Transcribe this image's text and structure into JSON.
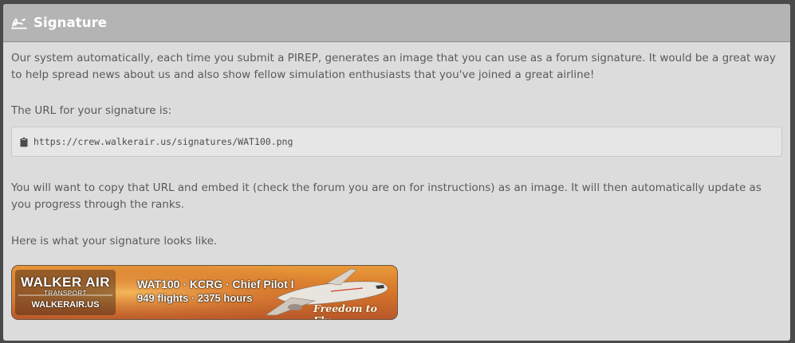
{
  "panel": {
    "title": "Signature",
    "icon": "signature-icon"
  },
  "content": {
    "intro": "Our system automatically, each time you submit a PIREP, generates an image that you can use as a forum signature. It would be a great way to help spread news about us and also show fellow simulation enthusiasts that you've joined a great airline!",
    "url_label": "The URL for your signature is:",
    "url_icon": "clipboard-icon",
    "url": "https://crew.walkerair.us/signatures/WAT100.png",
    "embed_text": "You will want to copy that URL and embed it (check the forum you are on for instructions) as an image. It will then automatically update as you progress through the ranks.",
    "preview_label": "Here is what your signature looks like."
  },
  "signature_image": {
    "logo_text": "WALKER AIR",
    "logo_sub": "TRANSPORT",
    "site": "WALKERAIR.US",
    "line1": "WAT100 · KCRG · Chief Pilot I",
    "line2": "949 flights · 2375 hours",
    "slogan": "Freedom to Fly"
  },
  "colors": {
    "header_bg": "#b4b4b4",
    "panel_bg": "#dcdcdc",
    "page_bg": "#4a4a4a",
    "text": "#5a5a5a"
  }
}
